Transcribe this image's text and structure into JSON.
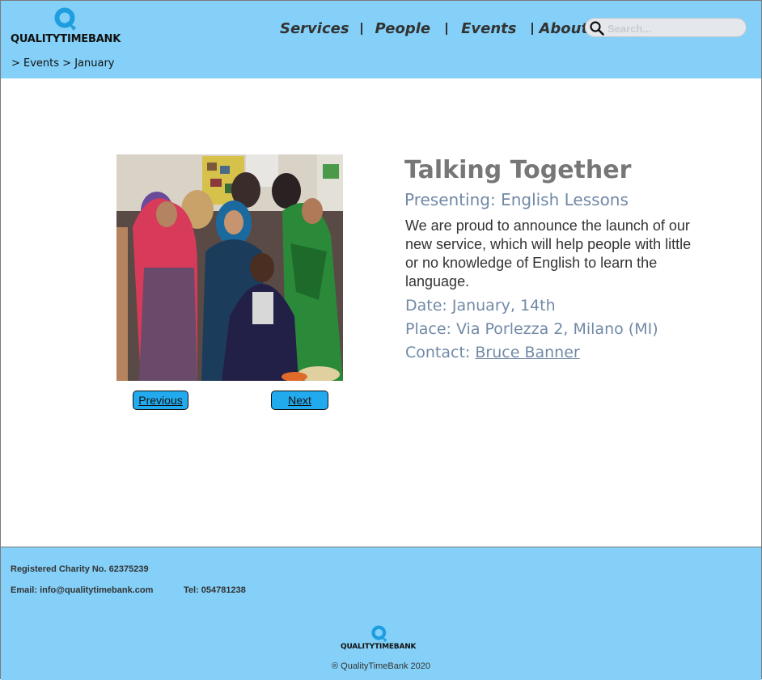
{
  "header": {
    "logo_text": "QUALITYTIMEBANK",
    "nav": [
      "Services",
      "People",
      "Events",
      "About Us"
    ],
    "search_placeholder": "Search...",
    "breadcrumb": "> Events > January"
  },
  "event": {
    "title": "Talking Together",
    "subtitle": "Presenting: English Lessons",
    "description": "We are proud to announce the launch of our new service, which will help people with little or no knowledge of English to learn the language.",
    "date": "Date: January, 14th",
    "place": "Place: Via Porlezza 2, Milano (MI)",
    "contact_label": "Contact: ",
    "contact_name": "Bruce Banner"
  },
  "pager": {
    "previous": "Previous",
    "next": "Next"
  },
  "footer": {
    "charity": "Registered Charity No. 62375239",
    "email": "Email:  info@qualitytimebank.com",
    "tel": "Tel: 054781238",
    "logo_text": "QUALITYTIMEBANK",
    "copyright": "® QualityTimeBank 2020"
  },
  "colors": {
    "header_bg": "#84d0f8",
    "footer_bg": "#84d0f8",
    "button_bg": "#22aaee",
    "logo_q": "#1e9ee0",
    "muted_blue": "#7189a6",
    "title_gray": "#777777"
  },
  "icons": {
    "logo": "q-logo-icon",
    "search": "magnifier-icon"
  }
}
